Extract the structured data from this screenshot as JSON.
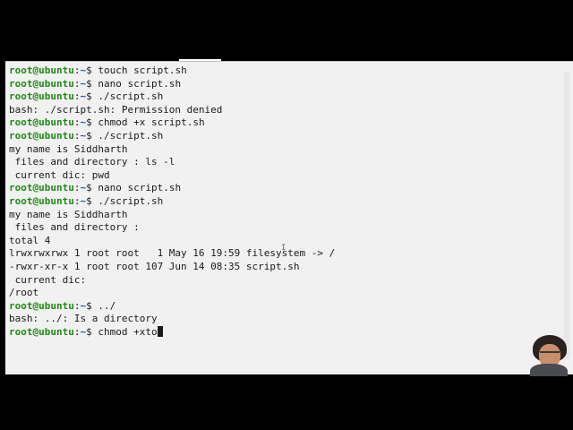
{
  "terminal": {
    "colors": {
      "background": "#f1f1f1",
      "text": "#1a1a1a",
      "prompt_user": "#1f8a12",
      "prompt_path": "#2f46c8"
    },
    "prompt": {
      "user_host": "root@ubuntu",
      "separator": ":",
      "path": "~",
      "symbol": "$ "
    },
    "lines": [
      {
        "kind": "prompt",
        "text": "touch script.sh"
      },
      {
        "kind": "prompt",
        "text": "nano script.sh"
      },
      {
        "kind": "prompt",
        "text": "./script.sh"
      },
      {
        "kind": "output",
        "text": "bash: ./script.sh: Permission denied"
      },
      {
        "kind": "prompt",
        "text": "chmod +x script.sh"
      },
      {
        "kind": "prompt",
        "text": "./script.sh"
      },
      {
        "kind": "output",
        "text": "my name is Siddharth"
      },
      {
        "kind": "output",
        "text": " files and directory : ls -l"
      },
      {
        "kind": "output",
        "text": " current dic: pwd"
      },
      {
        "kind": "prompt",
        "text": "nano script.sh"
      },
      {
        "kind": "prompt",
        "text": "./script.sh"
      },
      {
        "kind": "output",
        "text": "my name is Siddharth"
      },
      {
        "kind": "output",
        "text": " files and directory :"
      },
      {
        "kind": "output",
        "text": "total 4"
      },
      {
        "kind": "output",
        "text": "lrwxrwxrwx 1 root root   1 May 16 19:59 filesystem -> /"
      },
      {
        "kind": "output",
        "text": "-rwxr-xr-x 1 root root 107 Jun 14 08:35 script.sh"
      },
      {
        "kind": "output",
        "text": " current dic:"
      },
      {
        "kind": "output",
        "text": "/root"
      },
      {
        "kind": "prompt",
        "text": "../"
      },
      {
        "kind": "output",
        "text": "bash: ../: Is a directory"
      },
      {
        "kind": "prompt",
        "text": "chmod +xto",
        "cursor": true
      }
    ]
  },
  "mouse_pointer": {
    "glyph": "I"
  },
  "overlay": {
    "avatar_icon": "presenter-avatar-icon"
  }
}
